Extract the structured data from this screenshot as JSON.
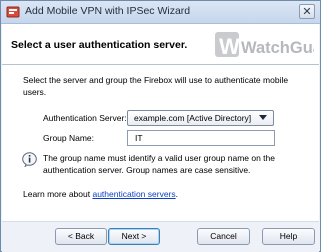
{
  "window": {
    "title": "Add Mobile VPN with IPSec Wizard",
    "close_glyph": "✕"
  },
  "header": {
    "title": "Select a user authentication server.",
    "logo_text": "WatchGuard",
    "logo_color": "#b5b8bd"
  },
  "main": {
    "intro": "Select the server and group the Firebox will use to authenticate mobile users.",
    "auth_server": {
      "label": "Authentication Server:",
      "value": "example.com [Active Directory]"
    },
    "group_name": {
      "label": "Group Name:",
      "value": "IT"
    },
    "note": "The group name must identify a valid user group name on the authentication server. Group names are case sensitive.",
    "learn_more": {
      "prefix": "Learn more about ",
      "link": "authentication servers",
      "suffix": "."
    }
  },
  "footer": {
    "back_label": "< Back",
    "next_label": "Next >",
    "cancel_label": "Cancel",
    "help_label": "Help"
  },
  "icons": {
    "title": "wizard-icon",
    "info": "info-icon",
    "dropdown": "chevron-down-icon"
  },
  "colors": {
    "link": "#0b3fc6",
    "default_button_border": "#3c7fb1"
  }
}
